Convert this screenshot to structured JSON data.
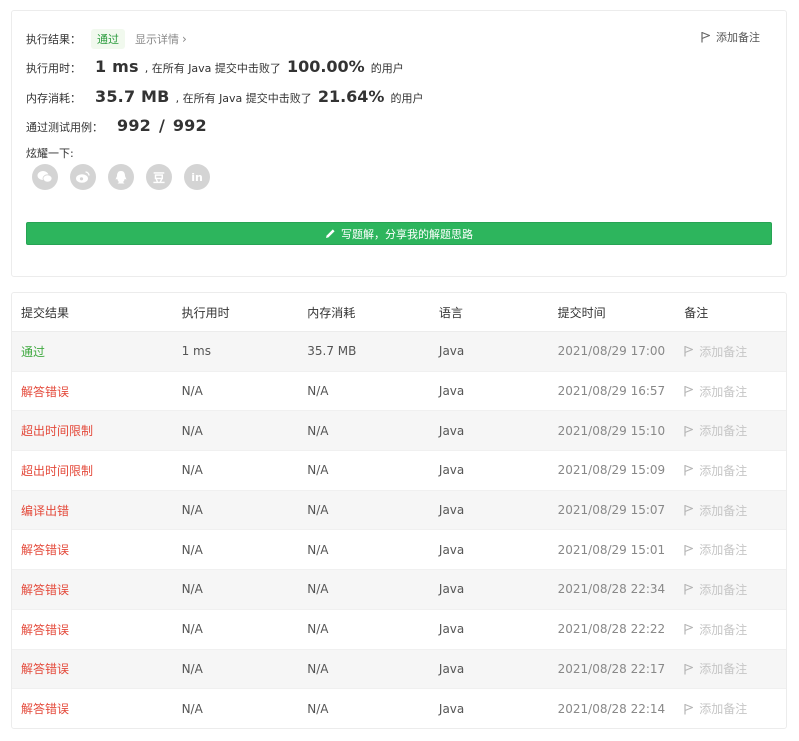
{
  "summary": {
    "result_label": "执行结果：",
    "result_badge": "通过",
    "show_details": "显示详情",
    "add_note": "添加备注",
    "runtime_label": "执行用时：",
    "runtime_value": "1 ms",
    "runtime_text": ", 在所有 Java 提交中击败了",
    "runtime_pct": "100.00%",
    "users_text": "的用户",
    "memory_label": "内存消耗：",
    "memory_value": "35.7 MB",
    "memory_text": ", 在所有 Java 提交中击败了",
    "memory_pct": "21.64%",
    "tests_label": "通过测试用例：",
    "tests_passed": "992",
    "tests_sep": "/",
    "tests_total": "992",
    "share_label": "炫耀一下:",
    "share_icons": [
      "wechat-icon",
      "weibo-icon",
      "qq-icon",
      "douban-icon",
      "linkedin-icon"
    ],
    "douban_glyph": "豆",
    "linkedin_glyph": "in",
    "write_button": "写题解，分享我的解题思路"
  },
  "table": {
    "headers": [
      "提交结果",
      "执行用时",
      "内存消耗",
      "语言",
      "提交时间",
      "备注"
    ],
    "rows": [
      {
        "status": "通过",
        "ok": true,
        "runtime": "1 ms",
        "memory": "35.7 MB",
        "lang": "Java",
        "time": "2021/08/29 17:00",
        "note": "添加备注"
      },
      {
        "status": "解答错误",
        "ok": false,
        "runtime": "N/A",
        "memory": "N/A",
        "lang": "Java",
        "time": "2021/08/29 16:57",
        "note": "添加备注"
      },
      {
        "status": "超出时间限制",
        "ok": false,
        "runtime": "N/A",
        "memory": "N/A",
        "lang": "Java",
        "time": "2021/08/29 15:10",
        "note": "添加备注"
      },
      {
        "status": "超出时间限制",
        "ok": false,
        "runtime": "N/A",
        "memory": "N/A",
        "lang": "Java",
        "time": "2021/08/29 15:09",
        "note": "添加备注"
      },
      {
        "status": "编译出错",
        "ok": false,
        "runtime": "N/A",
        "memory": "N/A",
        "lang": "Java",
        "time": "2021/08/29 15:07",
        "note": "添加备注"
      },
      {
        "status": "解答错误",
        "ok": false,
        "runtime": "N/A",
        "memory": "N/A",
        "lang": "Java",
        "time": "2021/08/29 15:01",
        "note": "添加备注"
      },
      {
        "status": "解答错误",
        "ok": false,
        "runtime": "N/A",
        "memory": "N/A",
        "lang": "Java",
        "time": "2021/08/28 22:34",
        "note": "添加备注"
      },
      {
        "status": "解答错误",
        "ok": false,
        "runtime": "N/A",
        "memory": "N/A",
        "lang": "Java",
        "time": "2021/08/28 22:22",
        "note": "添加备注"
      },
      {
        "status": "解答错误",
        "ok": false,
        "runtime": "N/A",
        "memory": "N/A",
        "lang": "Java",
        "time": "2021/08/28 22:17",
        "note": "添加备注"
      },
      {
        "status": "解答错误",
        "ok": false,
        "runtime": "N/A",
        "memory": "N/A",
        "lang": "Java",
        "time": "2021/08/28 22:14",
        "note": "添加备注"
      }
    ]
  },
  "colors": {
    "accepted": "#3fa940",
    "error": "#e4493a",
    "button": "#2db55d"
  }
}
